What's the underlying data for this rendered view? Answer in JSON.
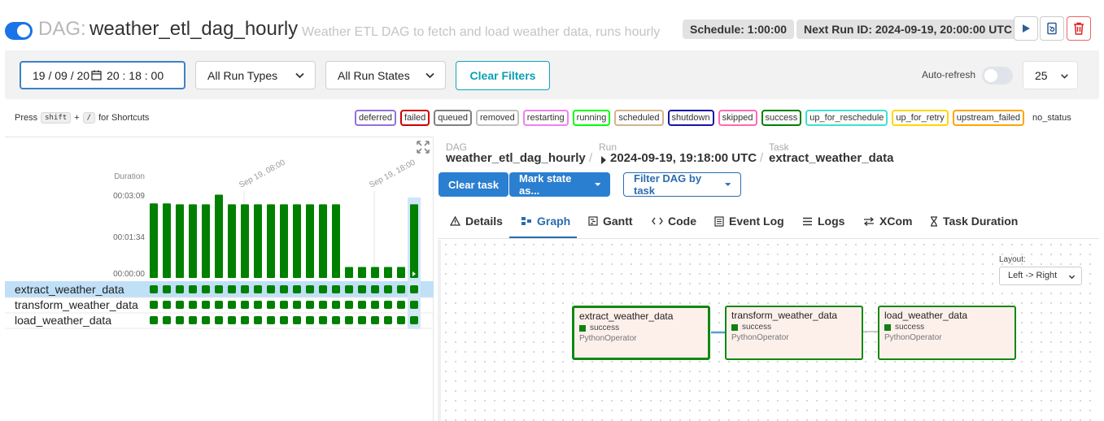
{
  "header": {
    "dag_prefix": "DAG:",
    "dag_id": "weather_etl_dag_hourly",
    "description": "Weather ETL DAG to fetch and load weather data, runs hourly",
    "schedule": "Schedule: 1:00:00",
    "next_run": "Next Run ID: 2024-09-19, 20:00:00 UTC"
  },
  "filters": {
    "date_value": "19 / 09 / 20",
    "time_value": "20 : 18 : 00",
    "run_types": "All Run Types",
    "run_states": "All Run States",
    "clear_filters": "Clear Filters",
    "auto_refresh": "Auto-refresh",
    "num_runs": "25"
  },
  "shortcuts": {
    "press": "Press",
    "key1": "shift",
    "plus": "+",
    "key2": "/",
    "suffix": "for Shortcuts"
  },
  "legend": [
    {
      "label": "deferred",
      "color": "#9370db"
    },
    {
      "label": "failed",
      "color": "#cc0000"
    },
    {
      "label": "queued",
      "color": "#808080"
    },
    {
      "label": "removed",
      "color": "#c0c0c0"
    },
    {
      "label": "restarting",
      "color": "#ee82ee"
    },
    {
      "label": "running",
      "color": "#00ff00"
    },
    {
      "label": "scheduled",
      "color": "#d2b48c"
    },
    {
      "label": "shutdown",
      "color": "#1515a8"
    },
    {
      "label": "skipped",
      "color": "#ff69b4"
    },
    {
      "label": "success",
      "color": "#008000"
    },
    {
      "label": "up_for_reschedule",
      "color": "#40e0d0"
    },
    {
      "label": "up_for_retry",
      "color": "#ffd700"
    },
    {
      "label": "upstream_failed",
      "color": "#ffa500"
    },
    {
      "label": "no_status",
      "color": "transparent"
    }
  ],
  "grid": {
    "duration_label": "Duration",
    "y_ticks": [
      "00:03:09",
      "00:01:34",
      "00:00:00"
    ],
    "date_labels": [
      "Sep 19, 08:00",
      "Sep 19, 18:00"
    ],
    "durations_sec": [
      170,
      170,
      168,
      168,
      168,
      190,
      168,
      168,
      168,
      168,
      168,
      168,
      168,
      168,
      168,
      25,
      25,
      25,
      25,
      25,
      168
    ],
    "tasks": [
      "extract_weather_data",
      "transform_weather_data",
      "load_weather_data"
    ],
    "success_color": "#008000"
  },
  "details": {
    "dag_label": "DAG",
    "dag_value": "weather_etl_dag_hourly",
    "run_label": "Run",
    "run_value": "2024-09-19, 19:18:00 UTC",
    "task_label": "Task",
    "task_value": "extract_weather_data",
    "clear_task": "Clear task",
    "mark_state": "Mark state as...",
    "filter_dag": "Filter DAG by task"
  },
  "tabs": [
    "Details",
    "Graph",
    "Gantt",
    "Code",
    "Event Log",
    "Logs",
    "XCom",
    "Task Duration"
  ],
  "graph": {
    "layout_label": "Layout:",
    "layout_value": "Left -> Right",
    "nodes": [
      {
        "name": "extract_weather_data",
        "state": "success",
        "operator": "PythonOperator"
      },
      {
        "name": "transform_weather_data",
        "state": "success",
        "operator": "PythonOperator"
      },
      {
        "name": "load_weather_data",
        "state": "success",
        "operator": "PythonOperator"
      }
    ]
  }
}
